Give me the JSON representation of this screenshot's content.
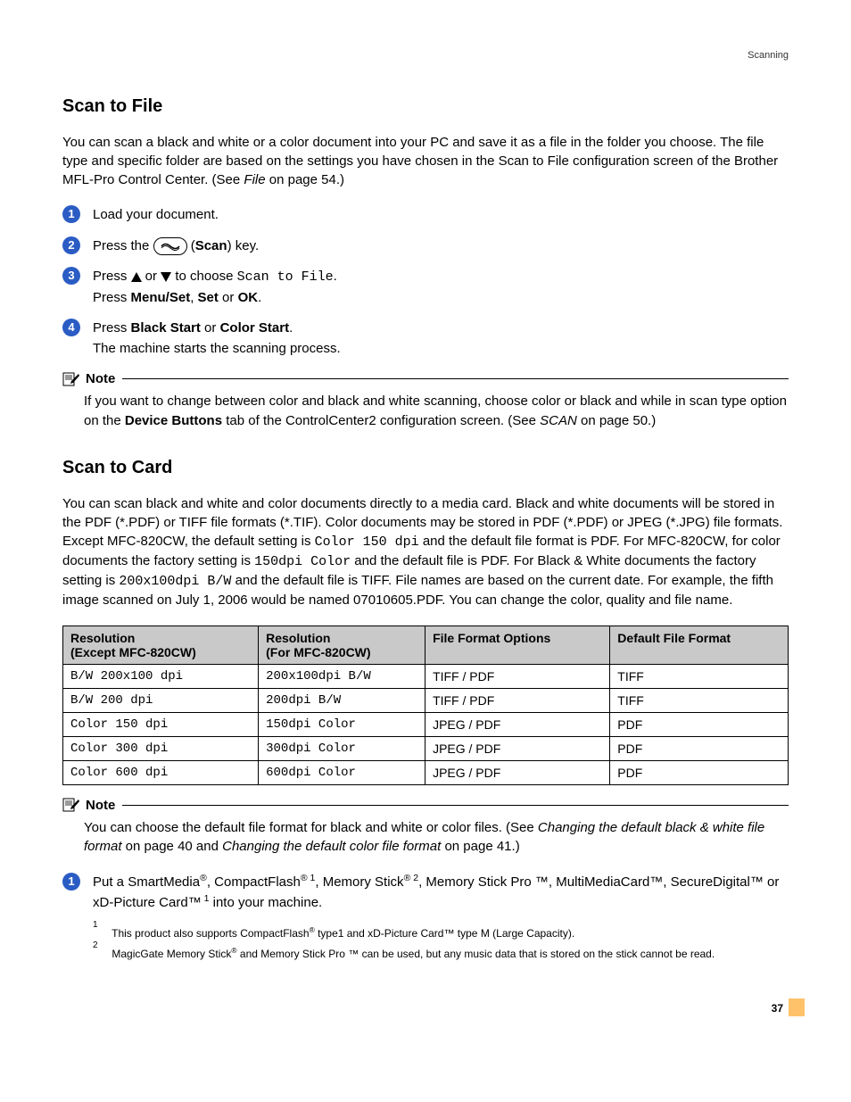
{
  "header": {
    "section_label": "Scanning"
  },
  "scan_to_file": {
    "title": "Scan to File",
    "intro_pre": "You can scan a black and white or a color document into your PC and save it as a file in the folder you choose. The file type and specific folder are based on the settings you have chosen in the Scan to File configuration screen of the Brother MFL-Pro Control Center. (See ",
    "intro_link": "File",
    "intro_post": " on page 54.)",
    "steps": {
      "s1": "Load your document.",
      "s2_pre": "Press the ",
      "s2_mid": " (",
      "s2_scan": "Scan",
      "s2_post": ") key.",
      "s3_a_pre": "Press ",
      "s3_a_mid": " or ",
      "s3_a_post": " to choose ",
      "s3_a_code": "Scan to File",
      "s3_a_end": ".",
      "s3_b_pre": "Press ",
      "s3_b_1": "Menu/Set",
      "s3_b_c1": ", ",
      "s3_b_2": "Set",
      "s3_b_c2": " or ",
      "s3_b_3": "OK",
      "s3_b_end": ".",
      "s4_a_pre": "Press ",
      "s4_a_1": "Black Start",
      "s4_a_c": " or ",
      "s4_a_2": "Color Start",
      "s4_a_end": ".",
      "s4_b": "The machine starts the scanning process."
    },
    "note": {
      "label": "Note",
      "body_pre": "If you want to change between color and  black and white scanning, choose color or black and while in scan type option on the ",
      "body_bold": "Device Buttons",
      "body_mid": " tab of the ControlCenter2 configuration screen. (See ",
      "body_link": "SCAN",
      "body_post": " on page 50.)"
    }
  },
  "scan_to_card": {
    "title": "Scan to Card",
    "intro_pre": "You can scan black and white and color documents directly to a media card. Black and white documents will be stored in the PDF (*.PDF) or TIFF file formats (*.TIF). Color documents may be stored in PDF (*.PDF) or JPEG (*.JPG) file formats. Except MFC-820CW, the default setting is ",
    "intro_code1": "Color 150 dpi",
    "intro_mid1": " and the default file format is PDF. For MFC-820CW, for color documents the factory setting is ",
    "intro_code2": "150dpi Color",
    "intro_mid2": " and the default file is PDF. For Black & White documents the factory setting is ",
    "intro_code3": "200x100dpi B/W",
    "intro_post": " and the default file is TIFF. File names are based on the current date. For example, the fifth image scanned on July 1, 2006 would be named 07010605.PDF. You can change the color, quality and file name.",
    "table": {
      "h1a": "Resolution",
      "h1b": "(Except MFC-820CW)",
      "h2a": "Resolution",
      "h2b": "(For MFC-820CW)",
      "h3": "File Format Options",
      "h4": "Default File Format",
      "rows": [
        {
          "c1": "B/W 200x100 dpi",
          "c2": "200x100dpi B/W",
          "c3": "TIFF / PDF",
          "c4": "TIFF"
        },
        {
          "c1": "B/W 200 dpi",
          "c2": "200dpi B/W",
          "c3": "TIFF / PDF",
          "c4": "TIFF"
        },
        {
          "c1": "Color 150 dpi",
          "c2": "150dpi Color",
          "c3": "JPEG / PDF",
          "c4": "PDF"
        },
        {
          "c1": "Color 300 dpi",
          "c2": "300dpi Color",
          "c3": "JPEG / PDF",
          "c4": "PDF"
        },
        {
          "c1": "Color 600 dpi",
          "c2": "600dpi Color",
          "c3": "JPEG / PDF",
          "c4": "PDF"
        }
      ]
    },
    "note": {
      "label": "Note",
      "body_pre": "You can choose the default file format for black and white or color files. (See ",
      "body_link1": "Changing the default black & white file format",
      "body_mid": " on page 40 and ",
      "body_link2": "Changing the default color file format",
      "body_post": " on page 41.)"
    },
    "step1": {
      "pre": "Put a SmartMedia",
      "sep1": ", CompactFlash",
      "fn1": " 1",
      "sep2": ", Memory Stick",
      "fn2": " 2",
      "sep3": ", Memory Stick Pro ™, MultiMediaCard™, SecureDigital™ or xD-Picture Card™",
      "fn1b": " 1",
      "post": " into your machine."
    },
    "footnotes": {
      "f1_num": "1",
      "f1_pre": "This product also supports CompactFlash",
      "f1_post": " type1 and xD-Picture Card™ type M (Large Capacity).",
      "f2_num": "2",
      "f2_pre": "MagicGate Memory Stick",
      "f2_post": " and Memory Stick Pro ™ can be used, but any music data that is stored on the stick cannot be read."
    }
  },
  "page_number": "37"
}
